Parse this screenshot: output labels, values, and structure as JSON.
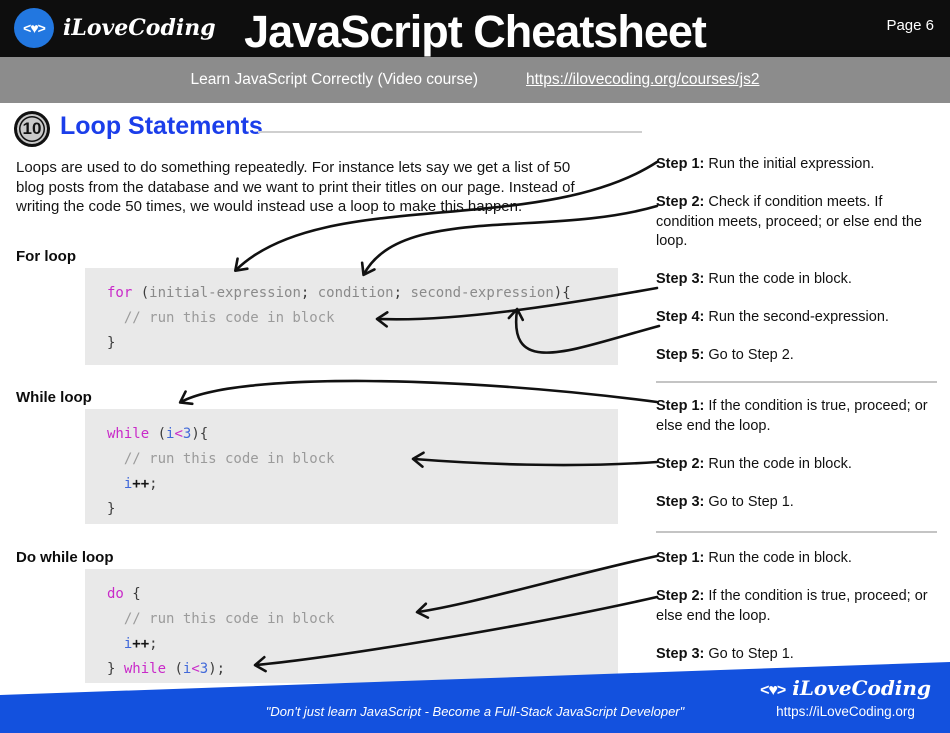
{
  "header": {
    "brand": "iLoveCoding",
    "logo_glyph": "<♥>",
    "title": "JavaScript Cheatsheet",
    "page_label": "Page 6",
    "subtitle": "Learn JavaScript Correctly (Video course)",
    "course_link": "https://ilovecoding.org/courses/js2"
  },
  "section": {
    "number": "10",
    "title": "Loop Statements",
    "intro": "Loops are used to do something repeatedly. For instance lets say we get a list of 50 blog posts from the database and we want to print their titles on our page. Instead of writing the code 50 times, we would instead use a loop to make this happen."
  },
  "loops": [
    {
      "label": "For loop",
      "code": [
        [
          {
            "t": "for",
            "c": "kw"
          },
          {
            "t": " (",
            "c": "pu"
          },
          {
            "t": "initial-expression",
            "c": "id"
          },
          {
            "t": ";",
            "c": "pu"
          },
          {
            "t": " condition",
            "c": "id"
          },
          {
            "t": ";",
            "c": "pu"
          },
          {
            "t": " second-expression",
            "c": "id"
          },
          {
            "t": "){",
            "c": "pu"
          }
        ],
        [
          {
            "t": "  // run this code in block",
            "c": "cm"
          }
        ],
        [
          {
            "t": "}",
            "c": "pu"
          }
        ]
      ],
      "steps": [
        {
          "label": "Step 1:",
          "text": "Run the initial expression."
        },
        {
          "label": "Step 2:",
          "text": "Check if condition meets. If condition meets, proceed; or else end the loop."
        },
        {
          "label": "Step 3:",
          "text": "Run the code in block."
        },
        {
          "label": "Step 4:",
          "text": "Run the second-expression."
        },
        {
          "label": "Step 5:",
          "text": "Go to Step 2."
        }
      ]
    },
    {
      "label": "While loop",
      "code": [
        [
          {
            "t": "while",
            "c": "kw"
          },
          {
            "t": " (",
            "c": "pu"
          },
          {
            "t": "i",
            "c": "vr"
          },
          {
            "t": "<",
            "c": "kw"
          },
          {
            "t": "3",
            "c": "vr"
          },
          {
            "t": "){",
            "c": "pu"
          }
        ],
        [
          {
            "t": "  // run this code in block",
            "c": "cm"
          }
        ],
        [
          {
            "t": "  ",
            "c": "pu"
          },
          {
            "t": "i",
            "c": "vr"
          },
          {
            "t": "++",
            "c": "op"
          },
          {
            "t": ";",
            "c": "pu"
          }
        ],
        [
          {
            "t": "}",
            "c": "pu"
          }
        ]
      ],
      "steps": [
        {
          "label": "Step 1:",
          "text": "If the condition is true, proceed; or else end the loop."
        },
        {
          "label": "Step 2:",
          "text": "Run the code in block."
        },
        {
          "label": "Step 3:",
          "text": "Go to Step 1."
        }
      ]
    },
    {
      "label": "Do while loop",
      "code": [
        [
          {
            "t": "do",
            "c": "kw"
          },
          {
            "t": " {",
            "c": "pu"
          }
        ],
        [
          {
            "t": "  // run this code in block",
            "c": "cm"
          }
        ],
        [
          {
            "t": "  ",
            "c": "pu"
          },
          {
            "t": "i",
            "c": "vr"
          },
          {
            "t": "++",
            "c": "op"
          },
          {
            "t": ";",
            "c": "pu"
          }
        ],
        [
          {
            "t": "} ",
            "c": "pu"
          },
          {
            "t": "while",
            "c": "kw"
          },
          {
            "t": " (",
            "c": "pu"
          },
          {
            "t": "i",
            "c": "vr"
          },
          {
            "t": "<",
            "c": "kw"
          },
          {
            "t": "3",
            "c": "vr"
          },
          {
            "t": ");",
            "c": "pu"
          }
        ]
      ],
      "steps": [
        {
          "label": "Step 1:",
          "text": "Run the code in block."
        },
        {
          "label": "Step 2:",
          "text": "If the condition is true, proceed; or else end the loop."
        },
        {
          "label": "Step 3:",
          "text": "Go to Step 1."
        }
      ]
    }
  ],
  "footer": {
    "quote": "\"Don't just learn JavaScript - Become a Full-Stack JavaScript Developer\"",
    "logo_glyph": "<♥>",
    "brand": "iLoveCoding",
    "url": "https://iLoveCoding.org"
  },
  "colors": {
    "header_bg": "#0e0e0e",
    "subbar_bg": "#8c8c8c",
    "logo_blue": "#2277e0",
    "heading_blue": "#1b3eea",
    "code_bg": "#e9e9e9",
    "keyword_magenta": "#c92ac9",
    "variable_blue": "#4169d9",
    "footer_blue": "#1351de"
  }
}
